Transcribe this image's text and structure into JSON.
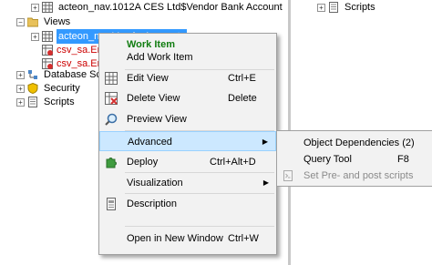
{
  "tree": {
    "rows": [
      {
        "label": "acteon_nav.1012A CES Ltd$Vendor Bank Account"
      },
      {
        "label": "Views"
      },
      {
        "label": "acteon_nav.VendorAccounts"
      },
      {
        "label": "csv_sa.Emp"
      },
      {
        "label": "csv_sa.Emp"
      },
      {
        "label": "Database Sche"
      },
      {
        "label": "Security"
      },
      {
        "label": "Scripts"
      }
    ]
  },
  "right_tree": {
    "scripts_label": "Scripts"
  },
  "context_menu": {
    "items": [
      {
        "label": "Work Item",
        "shortcut": ""
      },
      {
        "label": "Add Work Item",
        "shortcut": ""
      },
      {
        "label": "Edit View",
        "shortcut": "Ctrl+E"
      },
      {
        "label": "Delete View",
        "shortcut": "Delete"
      },
      {
        "label": "Preview View",
        "shortcut": ""
      },
      {
        "label": "Advanced",
        "shortcut": ""
      },
      {
        "label": "Deploy",
        "shortcut": "Ctrl+Alt+D"
      },
      {
        "label": "Visualization",
        "shortcut": ""
      },
      {
        "label": "Description",
        "shortcut": ""
      },
      {
        "label": "Open in New Window",
        "shortcut": "Ctrl+W"
      }
    ]
  },
  "submenu": {
    "items": [
      {
        "label": "Object Dependencies (2)",
        "shortcut": ""
      },
      {
        "label": "Query Tool",
        "shortcut": "F8"
      },
      {
        "label": "Set Pre- and post scripts",
        "shortcut": ""
      }
    ]
  },
  "colors": {
    "work_item_green": "#107c10",
    "highlight": "#cce8ff",
    "selection": "#3399ff",
    "red_text": "#cc0000"
  }
}
